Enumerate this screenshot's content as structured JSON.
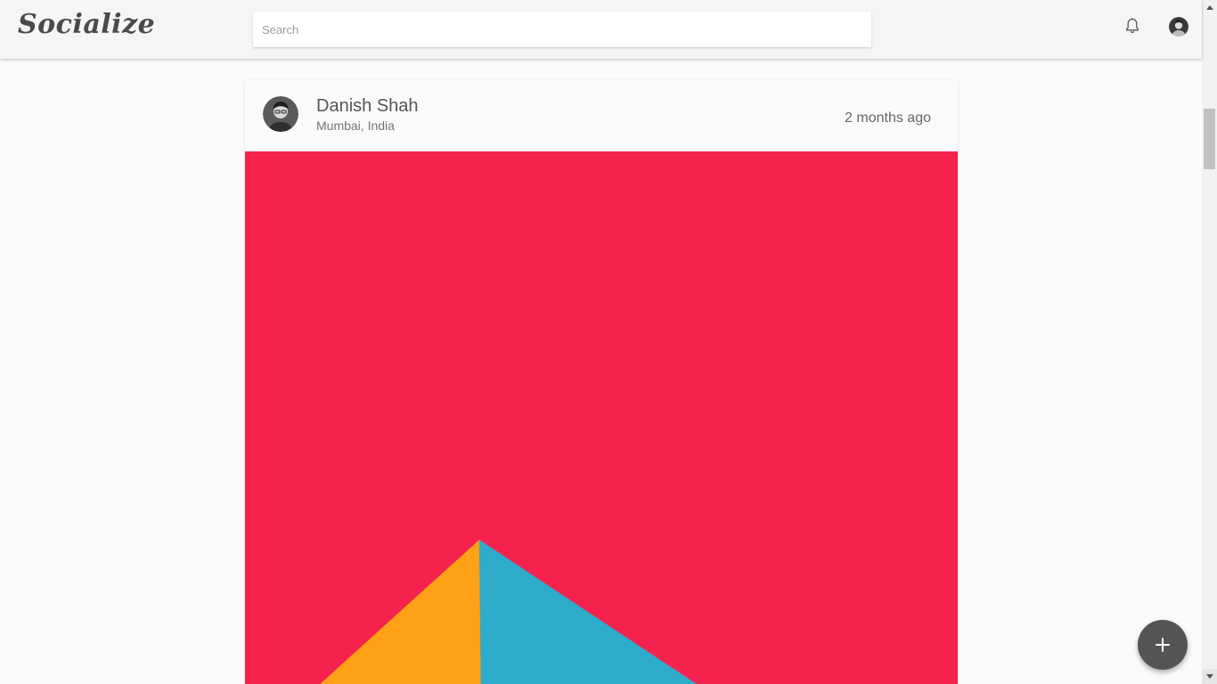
{
  "header": {
    "logo_text": "Socialize",
    "search_placeholder": "Search",
    "notification_icon": "bell-icon",
    "profile_icon": "user-avatar"
  },
  "post": {
    "author_name": "Danish Shah",
    "author_location": "Mumbai, India",
    "timestamp": "2 months ago",
    "image_colors": {
      "background": "#f5224e",
      "left_triangle": "#ffa116",
      "right_triangle": "#2eabcb"
    }
  },
  "fab": {
    "icon": "plus-icon"
  },
  "colors": {
    "page_bg": "#fafafa",
    "header_bg": "#f5f5f5",
    "fab_bg": "#555555"
  }
}
